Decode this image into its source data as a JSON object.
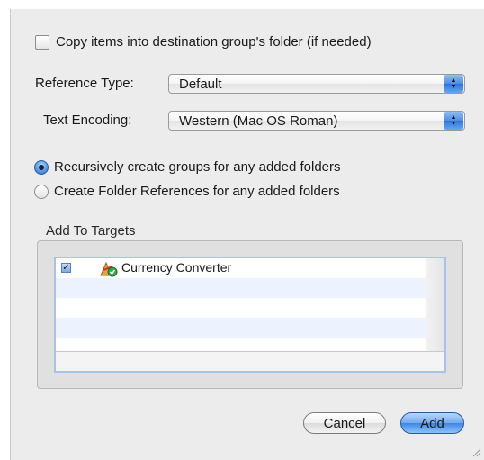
{
  "options": {
    "copy_items_label": "Copy items into destination group's folder (if needed)",
    "copy_items_checked": false
  },
  "reference_type": {
    "label": "Reference Type:",
    "value": "Default"
  },
  "text_encoding": {
    "label": "Text Encoding:",
    "value": "Western (Mac OS Roman)"
  },
  "folders": {
    "recursive_label": "Recursively create groups for any added folders",
    "references_label": "Create Folder References for any added folders",
    "selected": "recursive"
  },
  "targets": {
    "title": "Add To Targets",
    "items": [
      {
        "name": "Currency Converter",
        "checked": true,
        "check_glyph": "✓"
      }
    ]
  },
  "buttons": {
    "cancel": "Cancel",
    "add": "Add"
  },
  "colors": {
    "accent": "#3e86e4",
    "sheet_background": "#ececec"
  }
}
